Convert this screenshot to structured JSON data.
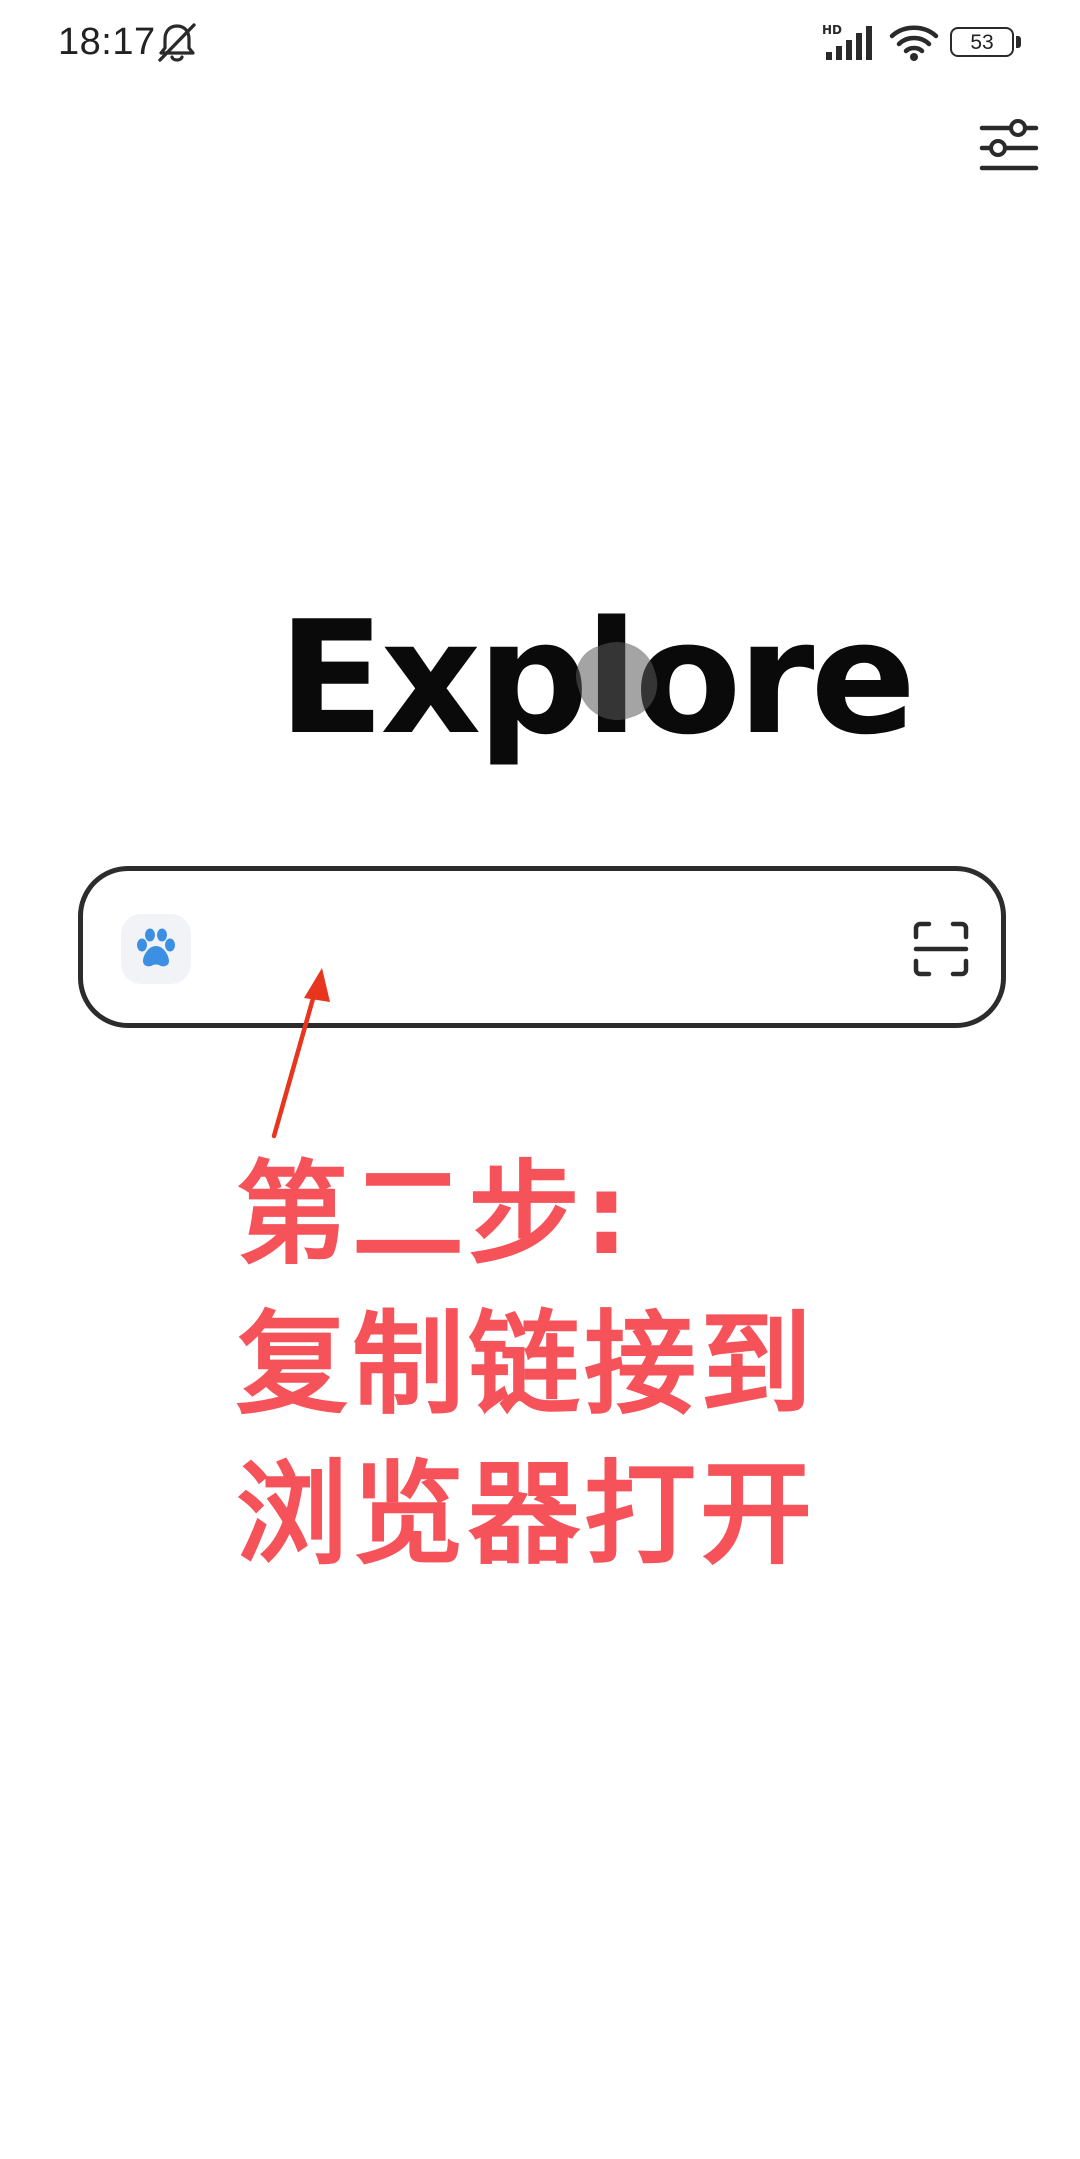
{
  "status_bar": {
    "time": "18:17",
    "battery_level": "53",
    "icons": [
      "mute-icon",
      "hd-signal-icon",
      "wifi-icon",
      "battery-icon"
    ]
  },
  "header": {
    "settings_icon": "sliders-icon"
  },
  "logo": {
    "text": "Explore"
  },
  "search": {
    "engine_icon": "paw-icon",
    "engine_color": "#3d8fe3",
    "value": "",
    "placeholder": "",
    "scan_icon": "scan-icon"
  },
  "annotation": {
    "color": "#f5525a",
    "lines": [
      "第二步:",
      "复制链接到",
      "浏览器打开"
    ]
  }
}
